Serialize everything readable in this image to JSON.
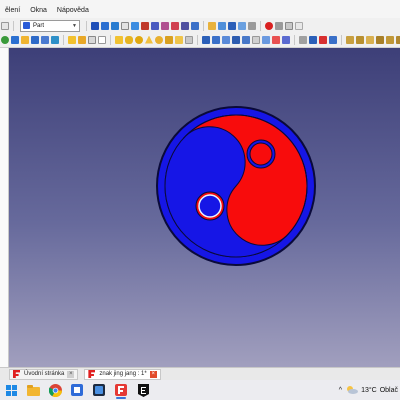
{
  "menubar": {
    "items": [
      "ělení",
      "Okna",
      "Nápověda"
    ]
  },
  "toolbar": {
    "workbench_selected": "Part"
  },
  "tabs": [
    {
      "label": "Úvodní stránka",
      "close": "×"
    },
    {
      "label": "znak jing jang : 1*",
      "close": "×"
    }
  ],
  "taskbar": {
    "apps": [
      "start-icon",
      "file-explorer-icon",
      "chrome-icon",
      "files-icon",
      "app-icon",
      "freecad-icon",
      "epic-games-icon"
    ],
    "tray": {
      "chevron": "^",
      "temperature": "13°C",
      "weather": "Oblač"
    }
  },
  "colors": {
    "yin": "#1616e6",
    "yang": "#f80c0c",
    "view_top": "#3d3f78",
    "view_bottom": "#a19fbe",
    "selection_highlight": "#e8f4ff"
  }
}
